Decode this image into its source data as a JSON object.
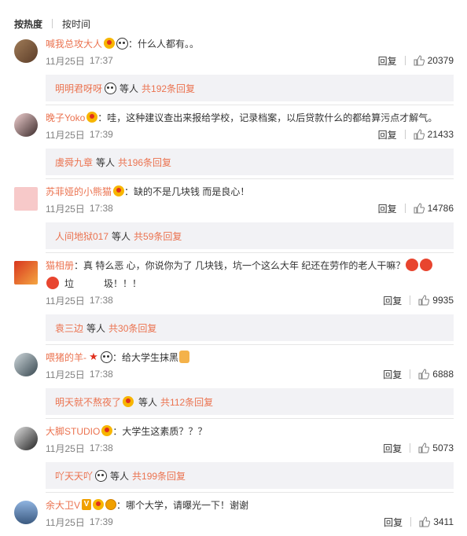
{
  "sort": {
    "hot": "按热度",
    "time": "按时间"
  },
  "ui": {
    "reply_label": "回复",
    "others_label": "等人"
  },
  "comments": [
    {
      "user": "喊我总攻大人",
      "text": "：什么人都有。。",
      "date": "11月25日",
      "time": "17:37",
      "likes": "20379",
      "reply_user": "明明君呀呀",
      "reply_count": "共192条回复"
    },
    {
      "user": "晚子Yoko",
      "text": "：哇，这种建议查出来报给学校，记录档案，以后贷款什么的都给算污点才解气。",
      "date": "11月25日",
      "time": "17:39",
      "likes": "21433",
      "reply_user": "虞舜九章",
      "reply_count": "共196条回复"
    },
    {
      "user": "苏菲娅的小熊猫",
      "text": "：缺的不是几块钱 而是良心！",
      "date": "11月25日",
      "time": "17:38",
      "likes": "14786",
      "reply_user": "人间地狱017",
      "reply_count": "共59条回复"
    },
    {
      "user": "猫相册",
      "text": "：真 特么恶 心，你说你为了 几块钱，坑一个这么大年 纪还在劳作的老人干嘛？",
      "text2": "垃",
      "text3": "圾！！！",
      "date": "11月25日",
      "time": "17:38",
      "likes": "9935",
      "reply_user": "袁三边",
      "reply_count": "共30条回复"
    },
    {
      "user": "喂猪的羊-",
      "text": "：给大学生抹黑",
      "date": "11月25日",
      "time": "17:38",
      "likes": "6888",
      "reply_user": "明天就不熬夜了",
      "reply_count": "共112条回复"
    },
    {
      "user": "大脚STUDIO",
      "text": "：大学生这素质？？？",
      "date": "11月25日",
      "time": "17:38",
      "likes": "5073",
      "reply_user": "吖天天吖",
      "reply_count": "共199条回复"
    },
    {
      "user": "余大卫V",
      "text": "：哪个大学，请曝光一下！谢谢",
      "date": "11月25日",
      "time": "17:39",
      "likes": "3411"
    }
  ],
  "colors": {
    "username": "#eb7350",
    "reply_bg": "#f2f2f5",
    "meta": "#808080"
  },
  "icons": [
    "thumb-up-icon",
    "vip-badge-icon",
    "panda-emoji-icon",
    "angry-emoji-icon",
    "thumb-down-emoji-icon",
    "red-star-icon"
  ]
}
